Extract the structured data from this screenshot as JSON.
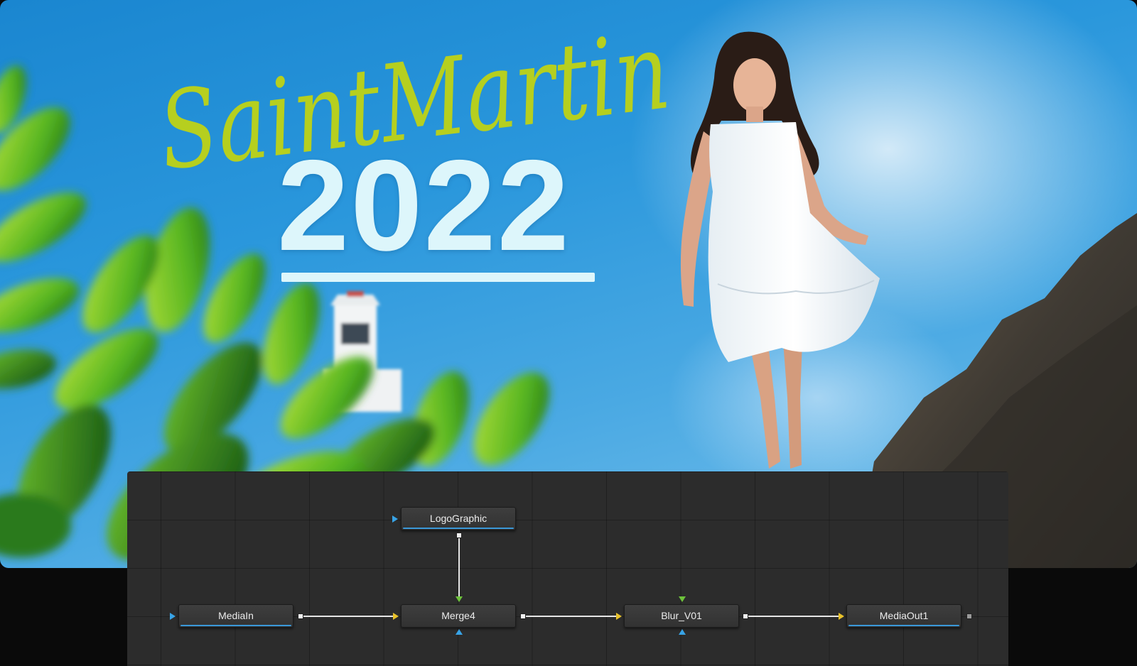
{
  "preview": {
    "script_title": "SaintMartin",
    "year": "2022"
  },
  "nodes": {
    "logo_graphic": "LogoGraphic",
    "media_in": "MediaIn",
    "merge": "Merge4",
    "blur": "Blur_V01",
    "media_out": "MediaOut1"
  },
  "colors": {
    "script_title": "#b6cf1f",
    "year_text": "#ddf6fb",
    "node_highlight": "#3a98d8",
    "input_port_yellow": "#e8c22a",
    "input_port_green": "#6dc23b",
    "input_port_blue": "#38a3e6",
    "panel_bg": "#2c2c2c"
  }
}
